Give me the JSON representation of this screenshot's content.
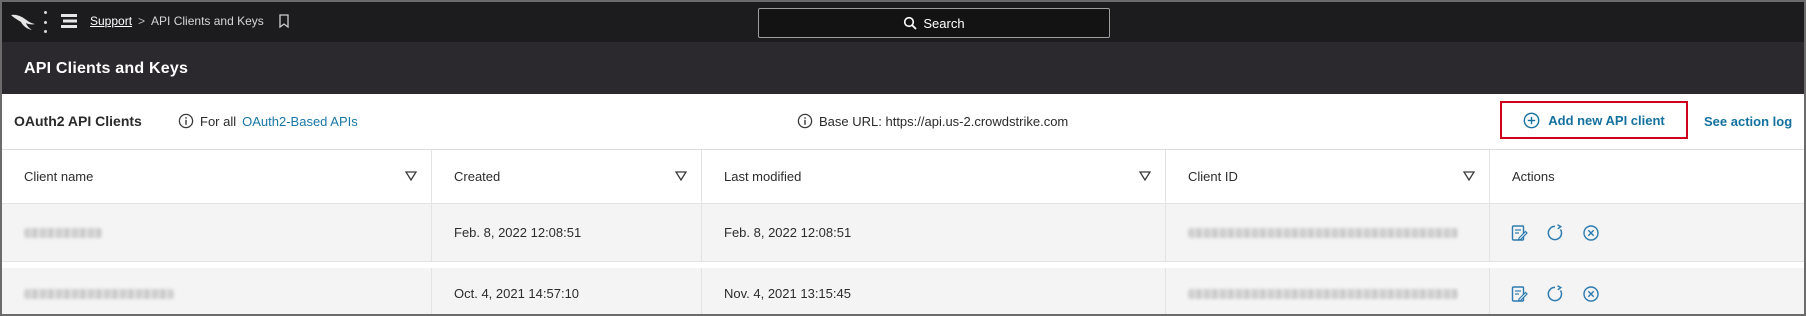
{
  "topbar": {
    "breadcrumb_link": "Support",
    "breadcrumb_sep": ">",
    "breadcrumb_current": "API Clients and Keys",
    "search_label": "Search"
  },
  "title": "API Clients and Keys",
  "subheader": {
    "section_title": "OAuth2 API Clients",
    "for_all_prefix": "For all",
    "for_all_link": "OAuth2-Based APIs",
    "base_url": "Base URL: https://api.us-2.crowdstrike.com",
    "add_button": "Add new API client",
    "action_log": "See action log"
  },
  "table": {
    "columns": [
      "Client name",
      "Created",
      "Last modified",
      "Client ID",
      "Actions"
    ],
    "rows": [
      {
        "created": "Feb. 8, 2022 12:08:51",
        "modified": "Feb. 8, 2022 12:08:51"
      },
      {
        "created": "Oct. 4, 2021 14:57:10",
        "modified": "Nov. 4, 2021 13:15:45"
      }
    ]
  },
  "icons": {
    "logo": "falcon-logo-icon",
    "kebab": "kebab-menu-icon",
    "menu": "hamburger-menu-icon",
    "bookmark": "bookmark-icon",
    "search": "search-icon",
    "info": "info-icon",
    "add": "plus-circle-icon",
    "sort": "chevron-down-icon",
    "edit": "edit-icon",
    "reset": "reset-secret-icon",
    "delete": "delete-circle-icon"
  },
  "colors": {
    "topbar": "#1c1b1d",
    "titlebar": "#2b292d",
    "link": "#14719f",
    "highlight": "#d0021b"
  }
}
